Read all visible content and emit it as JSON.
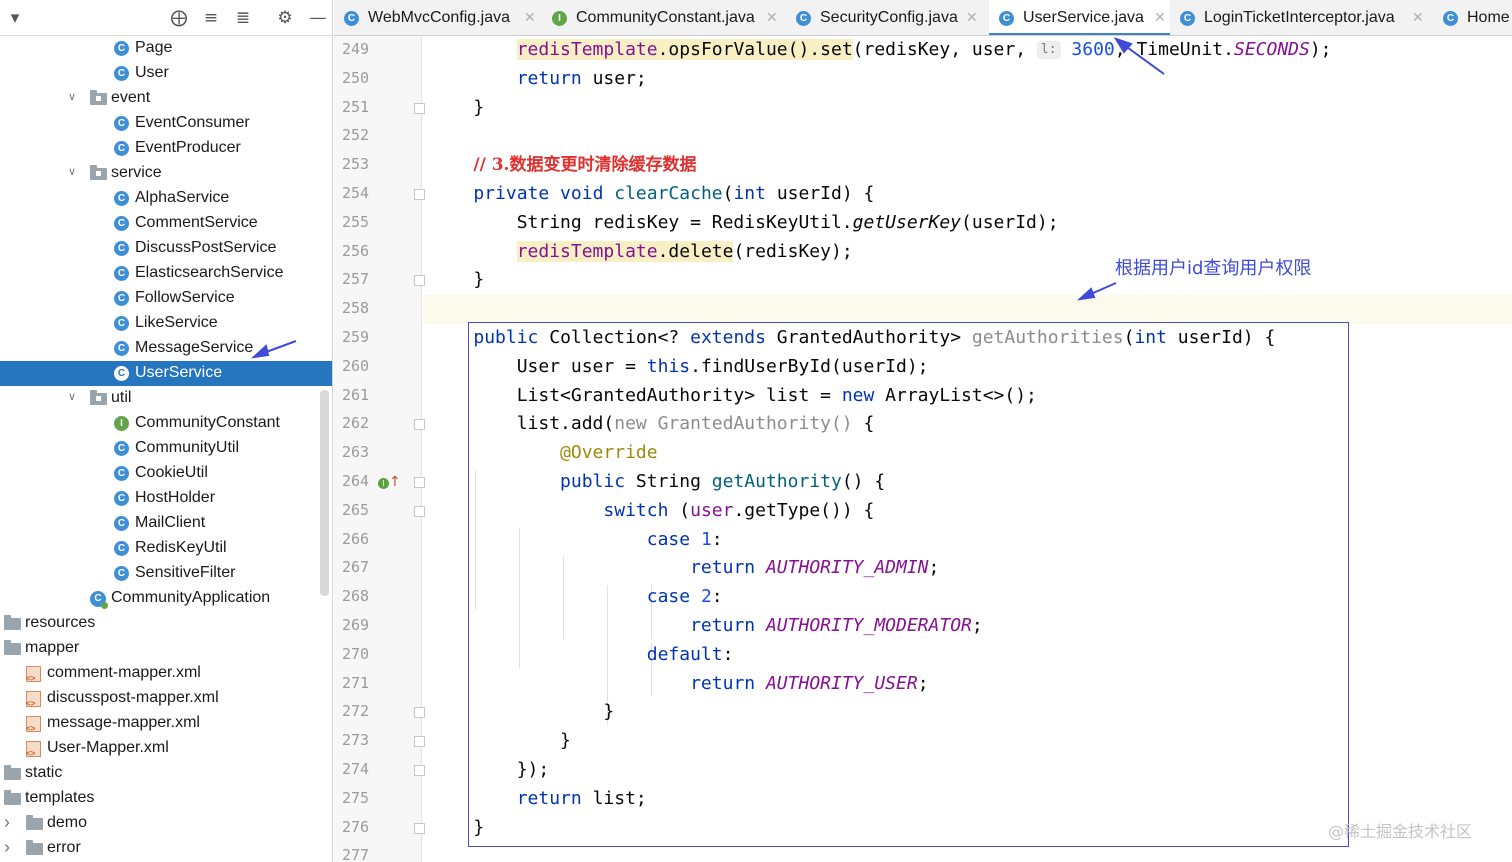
{
  "toolbar": {
    "icons": [
      "chevron-down-icon",
      "locate-icon",
      "expand-all-icon",
      "collapse-all-icon",
      "gear-icon",
      "minimize-icon"
    ]
  },
  "tree": {
    "items": [
      {
        "label": "Page",
        "kind": "class",
        "level": 3
      },
      {
        "label": "User",
        "kind": "class",
        "level": 3
      },
      {
        "label": "event",
        "kind": "package",
        "level": 2,
        "expanded": true
      },
      {
        "label": "EventConsumer",
        "kind": "class",
        "level": 3
      },
      {
        "label": "EventProducer",
        "kind": "class",
        "level": 3
      },
      {
        "label": "service",
        "kind": "package",
        "level": 2,
        "expanded": true
      },
      {
        "label": "AlphaService",
        "kind": "class",
        "level": 3
      },
      {
        "label": "CommentService",
        "kind": "class",
        "level": 3
      },
      {
        "label": "DiscussPostService",
        "kind": "class",
        "level": 3
      },
      {
        "label": "ElasticsearchService",
        "kind": "class",
        "level": 3
      },
      {
        "label": "FollowService",
        "kind": "class",
        "level": 3
      },
      {
        "label": "LikeService",
        "kind": "class",
        "level": 3
      },
      {
        "label": "MessageService",
        "kind": "class",
        "level": 3
      },
      {
        "label": "UserService",
        "kind": "class",
        "level": 3,
        "selected": true
      },
      {
        "label": "util",
        "kind": "package",
        "level": 2,
        "expanded": true
      },
      {
        "label": "CommunityConstant",
        "kind": "interface",
        "level": 3
      },
      {
        "label": "CommunityUtil",
        "kind": "class",
        "level": 3
      },
      {
        "label": "CookieUtil",
        "kind": "class",
        "level": 3
      },
      {
        "label": "HostHolder",
        "kind": "class",
        "level": 3
      },
      {
        "label": "MailClient",
        "kind": "class",
        "level": 3
      },
      {
        "label": "RedisKeyUtil",
        "kind": "class",
        "level": 3
      },
      {
        "label": "SensitiveFilter",
        "kind": "class",
        "level": 3
      },
      {
        "label": "CommunityApplication",
        "kind": "app",
        "level": 2
      },
      {
        "label": "resources",
        "kind": "resfolder",
        "level": 0
      },
      {
        "label": "mapper",
        "kind": "folder",
        "level": 0,
        "expanded": true
      },
      {
        "label": "comment-mapper.xml",
        "kind": "xml",
        "level": 1
      },
      {
        "label": "discusspost-mapper.xml",
        "kind": "xml",
        "level": 1
      },
      {
        "label": "message-mapper.xml",
        "kind": "xml",
        "level": 1
      },
      {
        "label": "User-Mapper.xml",
        "kind": "xml",
        "level": 1
      },
      {
        "label": "static",
        "kind": "folder",
        "level": 0,
        "expanded": false
      },
      {
        "label": "templates",
        "kind": "folder",
        "level": 0,
        "expanded": true
      },
      {
        "label": "demo",
        "kind": "folder",
        "level": 1,
        "expanded": false
      },
      {
        "label": "error",
        "kind": "folder",
        "level": 1,
        "expanded": false
      }
    ]
  },
  "tabs": [
    {
      "label": "WebMvcConfig.java",
      "icon": "C",
      "kind": "class"
    },
    {
      "label": "CommunityConstant.java",
      "icon": "I",
      "kind": "interface"
    },
    {
      "label": "SecurityConfig.java",
      "icon": "C",
      "kind": "class"
    },
    {
      "label": "UserService.java",
      "icon": "C",
      "kind": "class",
      "active": true
    },
    {
      "label": "LoginTicketInterceptor.java",
      "icon": "C",
      "kind": "class"
    },
    {
      "label": "Home",
      "icon": "C",
      "kind": "class"
    }
  ],
  "editor": {
    "line_numbers": [
      "249",
      "250",
      "251",
      "252",
      "253",
      "254",
      "255",
      "256",
      "257",
      "258",
      "259",
      "260",
      "261",
      "262",
      "263",
      "264",
      "265",
      "266",
      "267",
      "268",
      "269",
      "270",
      "271",
      "272",
      "273",
      "274",
      "275",
      "276",
      "277"
    ],
    "param_hint": "l:",
    "lines": [
      [
        {
          "t": "        "
        },
        {
          "t": "redisTemplate",
          "c": "m hl"
        },
        {
          "t": ".opsForValue().set",
          "c": "hl"
        },
        {
          "t": "(redisKey, user, "
        },
        {
          "hint": true
        },
        {
          "t": " "
        },
        {
          "t": "3600",
          "c": "n"
        },
        {
          "t": ", TimeUnit."
        },
        {
          "t": "SECONDS",
          "c": "it"
        },
        {
          "t": ");"
        }
      ],
      [
        {
          "t": "        "
        },
        {
          "t": "return",
          "c": "k"
        },
        {
          "t": " user;"
        }
      ],
      [
        {
          "t": "    }"
        }
      ],
      [
        {
          "t": ""
        }
      ],
      [
        {
          "t": "    "
        },
        {
          "t": "// 3.数据变更时清除缓存数据",
          "c": "cm"
        }
      ],
      [
        {
          "t": "    "
        },
        {
          "t": "private void",
          "c": "k"
        },
        {
          "t": " "
        },
        {
          "t": "clearCache",
          "c": "f"
        },
        {
          "t": "("
        },
        {
          "t": "int",
          "c": "k"
        },
        {
          "t": " userId) {"
        }
      ],
      [
        {
          "t": "        String redisKey = RedisKeyUtil."
        },
        {
          "t": "getUserKey",
          "c": "sm"
        },
        {
          "t": "(userId);"
        }
      ],
      [
        {
          "t": "        "
        },
        {
          "t": "redisTemplate",
          "c": "m hl"
        },
        {
          "t": ".delete",
          "c": "hl"
        },
        {
          "t": "(redisKey);"
        }
      ],
      [
        {
          "t": "    }"
        }
      ],
      [
        {
          "t": ""
        }
      ],
      [
        {
          "t": "    "
        },
        {
          "t": "public",
          "c": "k"
        },
        {
          "t": " Collection<? "
        },
        {
          "t": "extends",
          "c": "k"
        },
        {
          "t": " GrantedAuthority> "
        },
        {
          "t": "getAuthorities",
          "c": "g"
        },
        {
          "t": "("
        },
        {
          "t": "int",
          "c": "k"
        },
        {
          "t": " userId) {"
        }
      ],
      [
        {
          "t": "        User user = "
        },
        {
          "t": "this",
          "c": "k"
        },
        {
          "t": ".findUserById(userId);"
        }
      ],
      [
        {
          "t": "        List<GrantedAuthority> list = "
        },
        {
          "t": "new",
          "c": "k"
        },
        {
          "t": " ArrayList<>();"
        }
      ],
      [
        {
          "t": "        list.add("
        },
        {
          "t": "new GrantedAuthority()",
          "c": "g"
        },
        {
          "t": " {"
        }
      ],
      [
        {
          "t": "            "
        },
        {
          "t": "@Override",
          "c": "an"
        }
      ],
      [
        {
          "t": "            "
        },
        {
          "t": "public",
          "c": "k"
        },
        {
          "t": " String "
        },
        {
          "t": "getAuthority",
          "c": "f"
        },
        {
          "t": "() {"
        }
      ],
      [
        {
          "t": "                "
        },
        {
          "t": "switch",
          "c": "k"
        },
        {
          "t": " ("
        },
        {
          "t": "user",
          "c": "m"
        },
        {
          "t": ".getType()) {"
        }
      ],
      [
        {
          "t": "                    "
        },
        {
          "t": "case",
          "c": "k"
        },
        {
          "t": " "
        },
        {
          "t": "1",
          "c": "n"
        },
        {
          "t": ":"
        }
      ],
      [
        {
          "t": "                        "
        },
        {
          "t": "return",
          "c": "k"
        },
        {
          "t": " "
        },
        {
          "t": "AUTHORITY_ADMIN",
          "c": "it"
        },
        {
          "t": ";"
        }
      ],
      [
        {
          "t": "                    "
        },
        {
          "t": "case",
          "c": "k"
        },
        {
          "t": " "
        },
        {
          "t": "2",
          "c": "n"
        },
        {
          "t": ":"
        }
      ],
      [
        {
          "t": "                        "
        },
        {
          "t": "return",
          "c": "k"
        },
        {
          "t": " "
        },
        {
          "t": "AUTHORITY_MODERATOR",
          "c": "it"
        },
        {
          "t": ";"
        }
      ],
      [
        {
          "t": "                    "
        },
        {
          "t": "default",
          "c": "k"
        },
        {
          "t": ":"
        }
      ],
      [
        {
          "t": "                        "
        },
        {
          "t": "return",
          "c": "k"
        },
        {
          "t": " "
        },
        {
          "t": "AUTHORITY_USER",
          "c": "it"
        },
        {
          "t": ";"
        }
      ],
      [
        {
          "t": "                }"
        }
      ],
      [
        {
          "t": "            }"
        }
      ],
      [
        {
          "t": "        });"
        }
      ],
      [
        {
          "t": "        "
        },
        {
          "t": "return",
          "c": "k"
        },
        {
          "t": " list;"
        }
      ],
      [
        {
          "t": "    }"
        }
      ],
      [
        {
          "t": ""
        }
      ]
    ]
  },
  "annotation": {
    "text": "根据用户id查询用户权限",
    "color": "#3f4bd8"
  },
  "watermark": "@稀土掘金技术社区",
  "colors": {
    "selection": "#2675bf",
    "keyword": "#0033b3",
    "field": "#871094",
    "number": "#1750eb",
    "comment": "#e03030",
    "annotation_box": "#4a4ccf"
  }
}
